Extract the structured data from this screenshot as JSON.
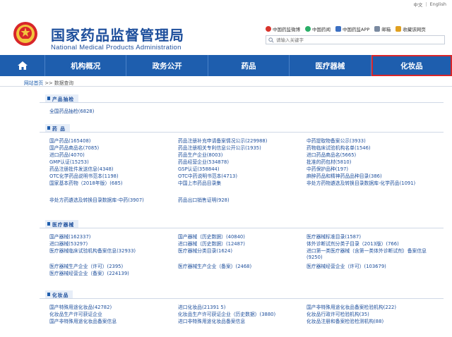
{
  "langbar": {
    "cn": "中文",
    "en": "English"
  },
  "header": {
    "title_cn": "国家药品监督管理局",
    "title_en": "National Medical Products Administration",
    "toplinks": [
      {
        "label": "中国药监微博",
        "icon": "weibo-icon"
      },
      {
        "label": "中国药闻",
        "icon": "wechat-icon"
      },
      {
        "label": "中国药监APP",
        "icon": "app-icon"
      },
      {
        "label": "邮箱",
        "icon": "mail-icon"
      },
      {
        "label": "收藏该网页",
        "icon": "favorite-icon"
      }
    ],
    "search_placeholder": "请输入关键字"
  },
  "nav": {
    "items": [
      {
        "label": "机构概况"
      },
      {
        "label": "政务公开"
      },
      {
        "label": "药品"
      },
      {
        "label": "医疗器械"
      },
      {
        "label": "化妆品",
        "active": true
      }
    ]
  },
  "breadcrumb": {
    "home": "网站首页",
    "sep": ">>",
    "current": "数据查询"
  },
  "sections": {
    "inspect": {
      "title": "产品抽检",
      "items": [
        "全国药品抽检(6828)"
      ]
    },
    "drug": {
      "title": "药 品",
      "col1": [
        "国产药品(165408)",
        "国产药品商品名(7085)",
        "进口药品(4070)",
        "GMP认证(15253)",
        "药品注册批件发送信息(4348)",
        "OTC化学药品说明书范本(1198)",
        "国家基本药物（2018年版）(685)"
      ],
      "col2": [
        "药品注册补充申请备案情况公示(229988)",
        "药品注册相关专利信息公开公示(1935)",
        "药品生产企业(8003)",
        "药品经营企业(534878)",
        "GSP认证(358844)",
        "OTC中药说明书范本(4713)",
        "中国上市药品目录集"
      ],
      "col3": [
        "中药提取物备案公示(3933)",
        "药物临床试验机构名单(1546)",
        "进口药品商品名(5665)",
        "批准的药包材(5810)",
        "中药保护品种(197)",
        "麻醉药品和精神药品品种目录(386)",
        "非处方药物遴选及转换目录数据库-化学药品(1091)"
      ],
      "row_extra": [
        "非处方药遴选及转换目录数据库-中药(3907)",
        "药品出口销售证明(928)"
      ]
    },
    "device": {
      "title": "医疗器械",
      "col1": [
        "国产器械(162337)",
        "进口器械(53297)",
        "医疗器械临床试验机构备案信息(32933)",
        "医疗器械生产企业（许可）(2395)",
        "医疗器械经营企业（备案）(224139)"
      ],
      "col2": [
        "国产器械（历史数据）(40840)",
        "进口器械（历史数据）(12487)",
        "医疗器械分类目录(1624)",
        "医疗器械生产企业（备案）(2468)"
      ],
      "col3": [
        "医疗器械标准目录(1587)",
        "体外诊断试剂分类子目录（2013版）(766)",
        "进口第一类医疗器械（含第一类体外诊断试剂）备案信息(9250)",
        "医疗器械经营企业（许可）(103679)"
      ]
    },
    "cosmetic": {
      "title": "化妆品",
      "col1": [
        "国产特殊用途化妆品(42782)",
        "化妆品生产许可获证企业",
        "国产非特殊用途化妆品备案信息"
      ],
      "col2": [
        "进口化妆品(21391 5)",
        "化妆品生产许可获证企业（历史数据）(3880)",
        "进口非特殊用途化妆品备案信息"
      ],
      "col3": [
        "国产非特殊用途化妆品备案检验机构(222)",
        "化妆品行政许可检验机构(35)",
        "化妆品注册和备案检验检测机构(88)"
      ]
    }
  },
  "colors": {
    "nav": "#1e5eae",
    "brand": "#1e4f9c",
    "active_outline": "#d9262a"
  }
}
